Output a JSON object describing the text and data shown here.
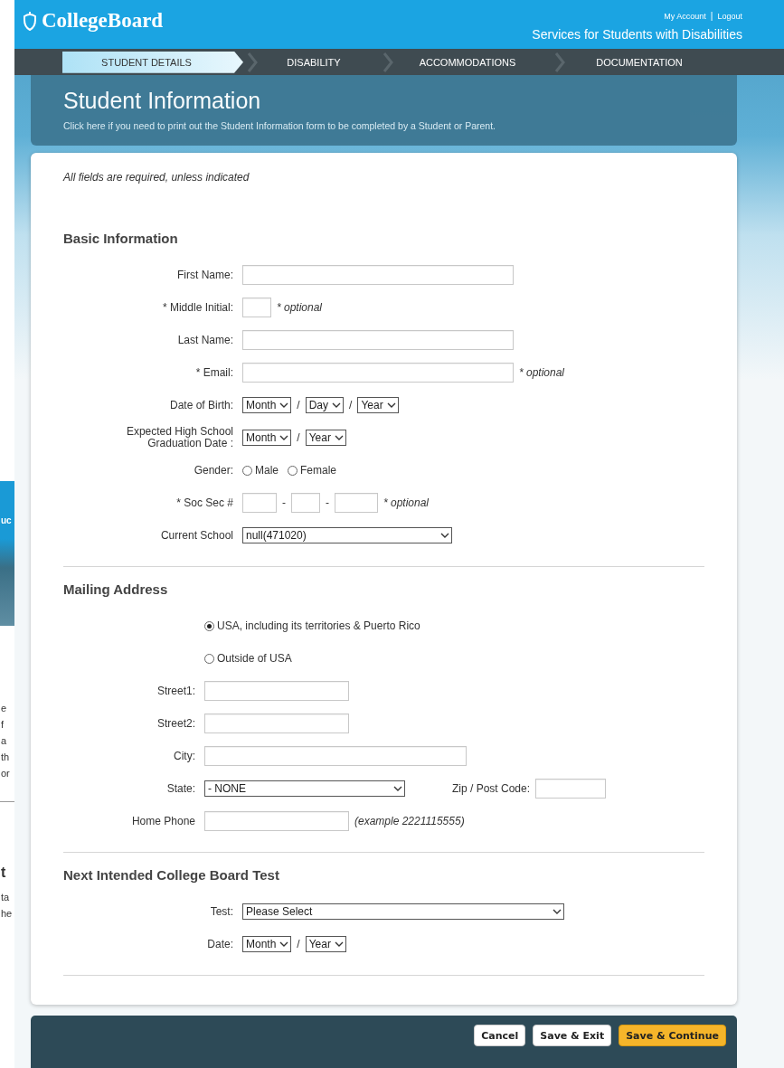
{
  "background_window": {
    "fragments": [
      {
        "text": "uc",
        "kind": "banner"
      },
      {
        "text": "e",
        "kind": "body"
      },
      {
        "text": "f",
        "kind": "body"
      },
      {
        "text": "a",
        "kind": "body"
      },
      {
        "text": "th",
        "kind": "body"
      },
      {
        "text": "or",
        "kind": "body"
      },
      {
        "text": "t",
        "kind": "heading"
      },
      {
        "text": "ta",
        "kind": "body"
      },
      {
        "text": "he",
        "kind": "body"
      }
    ]
  },
  "header": {
    "logo": "CollegeBoard",
    "links": [
      "My Account",
      "Logout"
    ],
    "link_separator": "|",
    "subtitle": "Services for Students with Disabilities"
  },
  "steps": [
    {
      "label": "STUDENT DETAILS",
      "selected": true
    },
    {
      "label": "DISABILITY",
      "selected": false
    },
    {
      "label": "ACCOMMODATIONS",
      "selected": false
    },
    {
      "label": "DOCUMENTATION",
      "selected": false
    }
  ],
  "page": {
    "title": "Student Information",
    "print_link": "Click here if you need to print out the Student Information form to be completed by a Student or Parent."
  },
  "required_note": "All fields are required, unless indicated",
  "sections": [
    {
      "heading": "Basic Information",
      "rows": [
        {
          "label": "First Name:",
          "parts": [
            {
              "kind": "input"
            }
          ]
        },
        {
          "label": "* Middle Initial:",
          "parts": [
            {
              "kind": "input"
            },
            {
              "kind": "note",
              "text": "* optional"
            }
          ]
        },
        {
          "label": "Last Name:",
          "parts": [
            {
              "kind": "input"
            }
          ]
        },
        {
          "label": "* Email:",
          "parts": [
            {
              "kind": "input"
            },
            {
              "kind": "note",
              "text": "* optional"
            }
          ]
        },
        {
          "label": "Date of Birth:",
          "parts": [
            {
              "kind": "select",
              "value": "Month"
            },
            {
              "kind": "sep",
              "text": "/"
            },
            {
              "kind": "select",
              "value": "Day"
            },
            {
              "kind": "sep",
              "text": "/"
            },
            {
              "kind": "select",
              "value": "Year"
            }
          ]
        },
        {
          "label": "Expected High School Graduation Date :",
          "parts": [
            {
              "kind": "select",
              "value": "Month"
            },
            {
              "kind": "sep",
              "text": "/"
            },
            {
              "kind": "select",
              "value": "Year"
            }
          ]
        },
        {
          "label": "Gender:",
          "parts": [
            {
              "kind": "radio",
              "text": "Male",
              "selected": false
            },
            {
              "kind": "radio",
              "text": "Female",
              "selected": false
            }
          ]
        },
        {
          "label": "* Soc Sec #",
          "parts": [
            {
              "kind": "input"
            },
            {
              "kind": "sep",
              "text": "-"
            },
            {
              "kind": "input"
            },
            {
              "kind": "sep",
              "text": "-"
            },
            {
              "kind": "input"
            },
            {
              "kind": "note",
              "text": "* optional"
            }
          ]
        },
        {
          "label": "Current School",
          "parts": [
            {
              "kind": "select",
              "value": "null(471020)"
            }
          ]
        }
      ]
    },
    {
      "heading": "Mailing Address",
      "rows": [
        {
          "parts": [
            {
              "kind": "radio",
              "text": "USA, including its territories & Puerto Rico",
              "selected": true
            }
          ]
        },
        {
          "parts": [
            {
              "kind": "radio",
              "text": "Outside of USA",
              "selected": false
            }
          ]
        },
        {
          "label": "Street1:",
          "parts": [
            {
              "kind": "input"
            }
          ]
        },
        {
          "label": "Street2:",
          "parts": [
            {
              "kind": "input"
            }
          ]
        },
        {
          "label": "City:",
          "parts": [
            {
              "kind": "input"
            }
          ]
        },
        {
          "label": "State:",
          "parts": [
            {
              "kind": "select",
              "value": "- NONE"
            },
            {
              "kind": "label",
              "text": "Zip / Post Code:"
            },
            {
              "kind": "input"
            }
          ]
        },
        {
          "label": "Home Phone",
          "parts": [
            {
              "kind": "input"
            },
            {
              "kind": "note",
              "text": "(example 2221115555)"
            }
          ]
        }
      ]
    },
    {
      "heading": "Next Intended College Board Test",
      "rows": [
        {
          "label": "Test:",
          "parts": [
            {
              "kind": "select",
              "value": "Please Select"
            }
          ]
        },
        {
          "label": "Date:",
          "parts": [
            {
              "kind": "select",
              "value": "Month"
            },
            {
              "kind": "sep",
              "text": "/"
            },
            {
              "kind": "select",
              "value": "Year"
            }
          ]
        }
      ]
    }
  ],
  "buttons": [
    {
      "label": "Cancel",
      "kind": "secondary"
    },
    {
      "label": "Save & Exit",
      "kind": "secondary"
    },
    {
      "label": "Save & Continue",
      "kind": "primary"
    }
  ]
}
